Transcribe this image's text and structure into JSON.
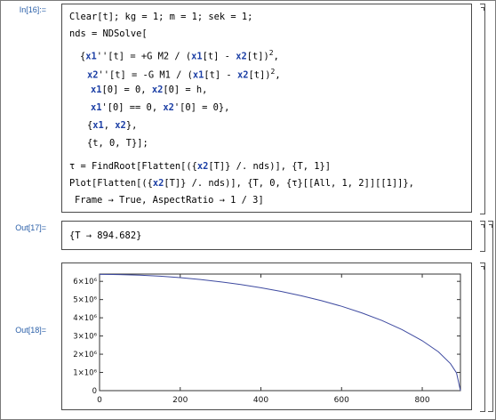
{
  "labels": {
    "in16": "In[16]:=",
    "out17": "Out[17]=",
    "out18": "Out[18]="
  },
  "input": {
    "l1": "Clear[t]; kg = 1; m = 1; sek = 1;",
    "l2": "nds = NDSolve[",
    "l3a": "{",
    "l3b": "x1",
    "l3c": "''[t] = +G M2 / (",
    "l3d": "x1",
    "l3e": "[t] - ",
    "l3f": "x2",
    "l3g": "[t])",
    "l3sup": "2",
    "l3h": ",",
    "l4b": "x2",
    "l4c": "''[t] = -G M1 / (",
    "l4d": "x1",
    "l4e": "[t] - ",
    "l4f": "x2",
    "l4g": "[t])",
    "l4sup": "2",
    "l4h": ",",
    "l5a": "x1",
    "l5b": "[0] = 0, ",
    "l5c": "x2",
    "l5d": "[0] = h,",
    "l6a": "x1",
    "l6b": "'[0] == 0, ",
    "l6c": "x2",
    "l6d": "'[0] = 0},",
    "l7a": "{",
    "l7b": "x1",
    "l7c": ", ",
    "l7d": "x2",
    "l7e": "},",
    "l8": "{t, 0, T}];",
    "l9a": "τ = FindRoot[Flatten[({",
    "l9b": "x2",
    "l9c": "[T]} /. nds)], {T, 1}]",
    "l10a": "Plot[Flatten[({",
    "l10b": "x2",
    "l10c": "[T]} /. nds)], {T, 0, {τ}[[All, 1, 2]][[1]]},",
    "l11": "Frame → True, AspectRatio → 1 / 3]"
  },
  "output17": {
    "text": "{T → 894.682}"
  },
  "chart_data": {
    "type": "line",
    "title": "",
    "xlabel": "",
    "ylabel": "",
    "xlim": [
      0,
      894.682
    ],
    "ylim": [
      0,
      6400000
    ],
    "xticks": [
      0,
      200,
      400,
      600,
      800
    ],
    "yticks": [
      0,
      1000000,
      2000000,
      3000000,
      4000000,
      5000000,
      6000000
    ],
    "ytick_labels": [
      "0",
      "1×10⁶",
      "2×10⁶",
      "3×10⁶",
      "4×10⁶",
      "5×10⁶",
      "6×10⁶"
    ],
    "series": [
      {
        "x": [
          0,
          50,
          100,
          150,
          200,
          250,
          300,
          350,
          400,
          450,
          500,
          550,
          600,
          650,
          700,
          750,
          800,
          840,
          870,
          885,
          894.682
        ],
        "values": [
          6380000,
          6370000,
          6340000,
          6285000,
          6205000,
          6100000,
          5975000,
          5825000,
          5650000,
          5445000,
          5210000,
          4940000,
          4630000,
          4270000,
          3850000,
          3350000,
          2740000,
          2130000,
          1480000,
          970000,
          0
        ],
        "color": "#3e4aa0"
      }
    ]
  }
}
